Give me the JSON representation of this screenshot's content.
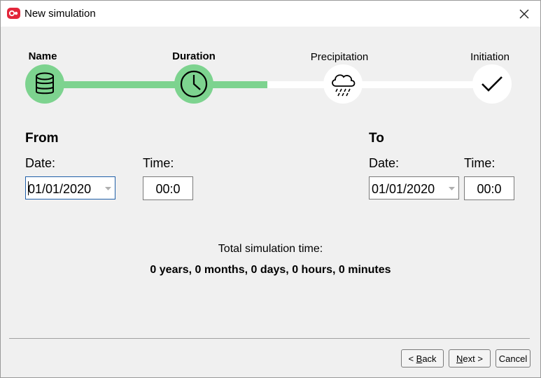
{
  "window": {
    "title": "New simulation",
    "icons": {
      "app": "app-logo-icon",
      "close": "close-icon"
    }
  },
  "stepper": {
    "steps": [
      {
        "label": "Name",
        "icon": "database-icon",
        "state": "completed"
      },
      {
        "label": "Duration",
        "icon": "clock-icon",
        "state": "current"
      },
      {
        "label": "Precipitation",
        "icon": "cloud-rain-icon",
        "state": "pending"
      },
      {
        "label": "Initiation",
        "icon": "checkmark-icon",
        "state": "pending"
      }
    ],
    "colors": {
      "done": "#7dd38f",
      "pending": "#ffffff"
    }
  },
  "from": {
    "title": "From",
    "date_label": "Date:",
    "date_value": "01/01/2020",
    "time_label": "Time:",
    "time_value": "00:0"
  },
  "to": {
    "title": "To",
    "date_label": "Date:",
    "date_value": "01/01/2020",
    "time_label": "Time:",
    "time_value": "00:0"
  },
  "summary": {
    "label": "Total simulation time:",
    "value": "0 years, 0 months, 0 days, 0 hours, 0 minutes"
  },
  "buttons": {
    "back": {
      "prefix": "< ",
      "mnemonic": "B",
      "rest": "ack"
    },
    "next": {
      "mnemonic": "N",
      "rest": "ext",
      "suffix": " >"
    },
    "cancel": "Cancel"
  }
}
